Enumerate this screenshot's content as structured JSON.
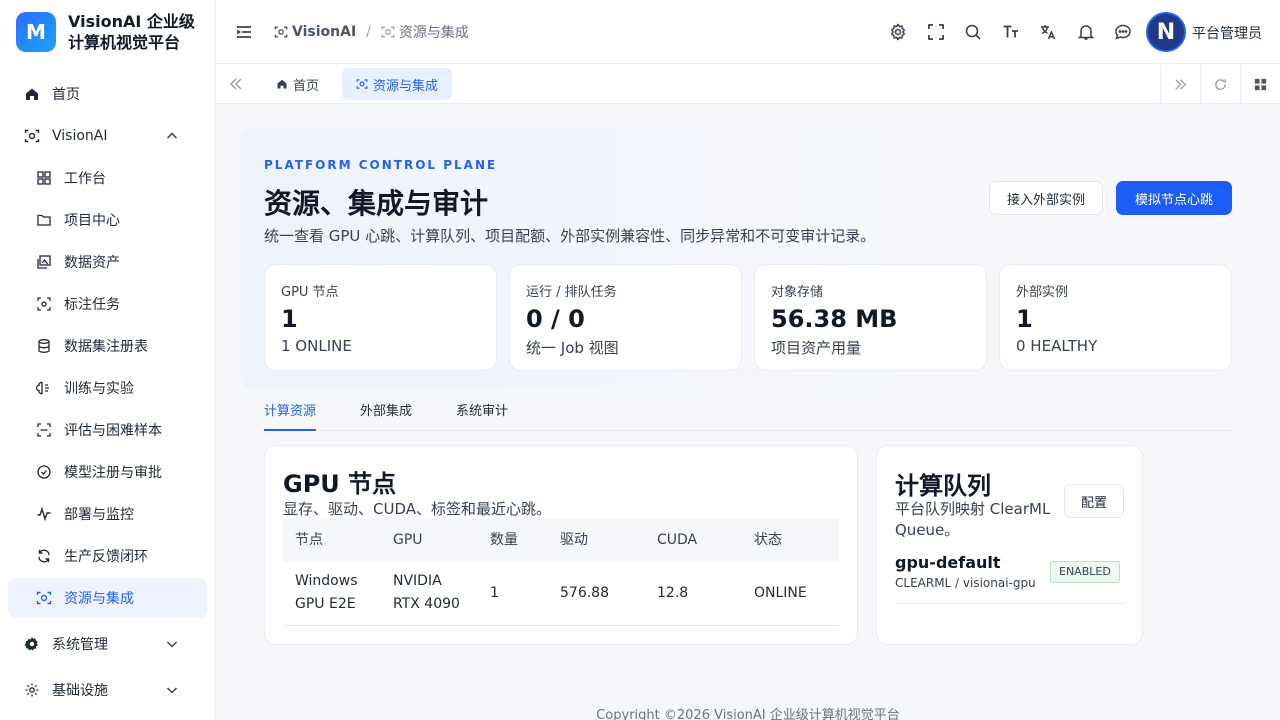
{
  "brand": {
    "logo_letter": "M",
    "name": "VisionAI 企业级计算机视觉平台"
  },
  "sidebar": {
    "items": [
      {
        "label": "首页",
        "icon": "home-icon",
        "level": "top"
      },
      {
        "label": "VisionAI",
        "icon": "scan-eye-icon",
        "level": "top",
        "expanded": true
      },
      {
        "label": "工作台",
        "icon": "dashboard-icon",
        "level": "sub"
      },
      {
        "label": "项目中心",
        "icon": "folder-icon",
        "level": "sub"
      },
      {
        "label": "数据资产",
        "icon": "images-icon",
        "level": "sub"
      },
      {
        "label": "标注任务",
        "icon": "scan-icon",
        "level": "sub"
      },
      {
        "label": "数据集注册表",
        "icon": "database-icon",
        "level": "sub"
      },
      {
        "label": "训练与实验",
        "icon": "brain-icon",
        "level": "sub"
      },
      {
        "label": "评估与困难样本",
        "icon": "scan-line-icon",
        "level": "sub"
      },
      {
        "label": "模型注册与审批",
        "icon": "check-circle-icon",
        "level": "sub"
      },
      {
        "label": "部署与监控",
        "icon": "activity-icon",
        "level": "sub"
      },
      {
        "label": "生产反馈闭环",
        "icon": "refresh-icon",
        "level": "sub"
      },
      {
        "label": "资源与集成",
        "icon": "scan-eye-icon",
        "level": "sub",
        "active": true
      },
      {
        "label": "系统管理",
        "icon": "gear-icon",
        "level": "top",
        "expanded": false
      },
      {
        "label": "基础设施",
        "icon": "gear-outline-icon",
        "level": "top",
        "expanded": false
      }
    ]
  },
  "header": {
    "breadcrumb": [
      "VisionAI",
      "资源与集成"
    ],
    "icons": [
      "settings-icon",
      "fullscreen-icon",
      "search-icon",
      "font-size-icon",
      "translate-icon",
      "bell-icon",
      "message-icon"
    ],
    "avatar_letter": "N",
    "user_name": "平台管理员"
  },
  "tabbar": {
    "tabs": [
      {
        "label": "首页"
      },
      {
        "label": "资源与集成",
        "active": true
      }
    ]
  },
  "page": {
    "eyebrow": "PLATFORM CONTROL PLANE",
    "title": "资源、集成与审计",
    "description": "统一查看 GPU 心跳、计算队列、项目配额、外部实例兼容性、同步异常和不可变审计记录。",
    "btn_connect": "接入外部实例",
    "btn_heartbeat": "模拟节点心跳"
  },
  "stats": [
    {
      "label": "GPU 节点",
      "value": "1",
      "sub": "1 ONLINE"
    },
    {
      "label": "运行 / 排队任务",
      "value": "0 / 0",
      "sub": "统一 Job 视图"
    },
    {
      "label": "对象存储",
      "value": "56.38 MB",
      "sub": "项目资产用量"
    },
    {
      "label": "外部实例",
      "value": "1",
      "sub": "0 HEALTHY"
    }
  ],
  "tabs": [
    "计算资源",
    "外部集成",
    "系统审计"
  ],
  "gpu_card": {
    "title": "GPU 节点",
    "description": "显存、驱动、CUDA、标签和最近心跳。",
    "columns": [
      "节点",
      "GPU",
      "数量",
      "驱动",
      "CUDA",
      "状态"
    ],
    "rows": [
      {
        "node": [
          "Windows",
          "GPU E2E"
        ],
        "gpu": [
          "NVIDIA",
          "RTX 4090"
        ],
        "count": "1",
        "driver": "576.88",
        "cuda": "12.8",
        "status": "ONLINE"
      }
    ]
  },
  "queue_card": {
    "title": "计算队列",
    "description": [
      "平台队列映射 ClearML",
      "Queue。"
    ],
    "config_label": "配置",
    "queue": {
      "name": "gpu-default",
      "meta": "CLEARML / visionai-gpu",
      "badge": "ENABLED"
    }
  },
  "footer": "Copyright ©2026 VisionAI 企业级计算机视觉平台",
  "colors": {
    "accent": "#2563eb",
    "primary_button": "#1d5cf5",
    "badge_bg": "#edf9f0"
  }
}
